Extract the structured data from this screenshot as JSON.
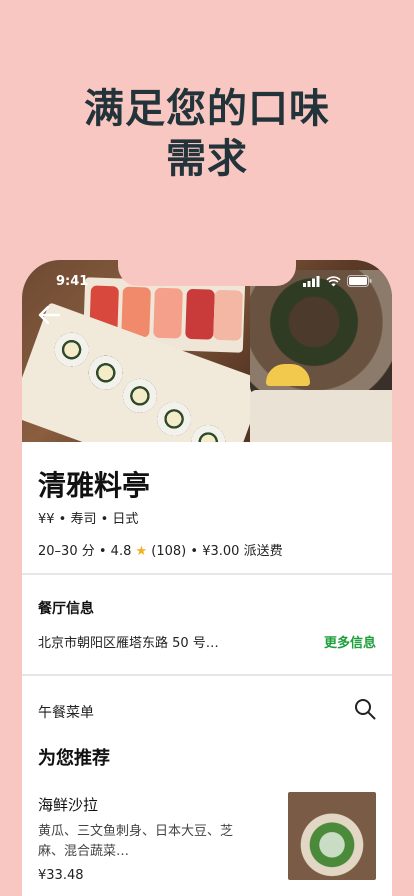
{
  "headline": {
    "line1": "满足您的口味",
    "line2": "需求"
  },
  "status_bar": {
    "time": "9:41"
  },
  "restaurant": {
    "name": "清雅料亭",
    "tags": "¥¥ • 寿司 • 日式",
    "delivery_time": "20–30 分",
    "rating": "4.8",
    "rating_count": "(108)",
    "delivery_fee": "¥3.00 派送费"
  },
  "info_section": {
    "title": "餐厅信息",
    "address": "北京市朝阳区雁塔东路 50 号…",
    "more_label": "更多信息"
  },
  "menu": {
    "label": "午餐菜单",
    "recommend_title": "为您推荐",
    "items": [
      {
        "name": "海鲜沙拉",
        "description": "黄瓜、三文鱼刺身、日本大豆、芝麻、混合蔬菜…",
        "price": "¥33.48"
      }
    ]
  },
  "colors": {
    "background": "#F9C7C2",
    "accent_green": "#1E9E3C",
    "star": "#F2B01E"
  },
  "icons": [
    "back-arrow-icon",
    "signal-icon",
    "wifi-icon",
    "battery-icon",
    "search-icon",
    "star-icon"
  ]
}
